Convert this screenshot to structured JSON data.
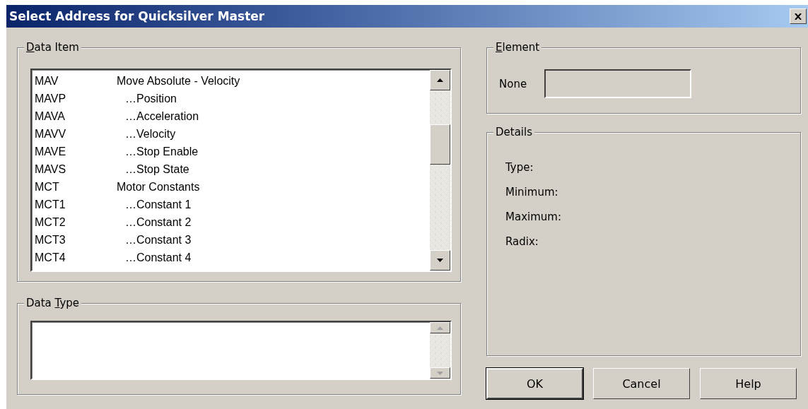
{
  "window": {
    "title": "Select Address for Quicksilver Master"
  },
  "data_item": {
    "label_key": "D",
    "label_post": "ata Item",
    "scrollbar_disabled": false,
    "items": [
      {
        "code": "MAV",
        "description": "Move Absolute - Velocity",
        "children": [
          {
            "code": "MAVP",
            "description": "…Position"
          },
          {
            "code": "MAVA",
            "description": "…Acceleration"
          },
          {
            "code": "MAVV",
            "description": "…Velocity"
          },
          {
            "code": "MAVE",
            "description": "…Stop Enable"
          },
          {
            "code": "MAVS",
            "description": "…Stop State"
          }
        ]
      },
      {
        "code": "MCT",
        "description": "Motor Constants",
        "children": [
          {
            "code": "MCT1",
            "description": "…Constant 1"
          },
          {
            "code": "MCT2",
            "description": "…Constant 2"
          },
          {
            "code": "MCT3",
            "description": "…Constant 3"
          },
          {
            "code": "MCT4",
            "description": "…Constant 4"
          }
        ]
      }
    ]
  },
  "data_type": {
    "label_pre": "Data ",
    "label_key": "T",
    "label_post": "ype",
    "scrollbar_disabled": true
  },
  "element": {
    "label_key": "E",
    "label_post": "lement",
    "field_label": "None"
  },
  "details": {
    "label": "Details",
    "fields": [
      "Type:",
      "Minimum:",
      "Maximum:",
      "Radix:"
    ]
  },
  "buttons": [
    {
      "label": "OK",
      "default": true
    },
    {
      "label": "Cancel",
      "default": false
    },
    {
      "label": "Help",
      "default": false
    }
  ]
}
